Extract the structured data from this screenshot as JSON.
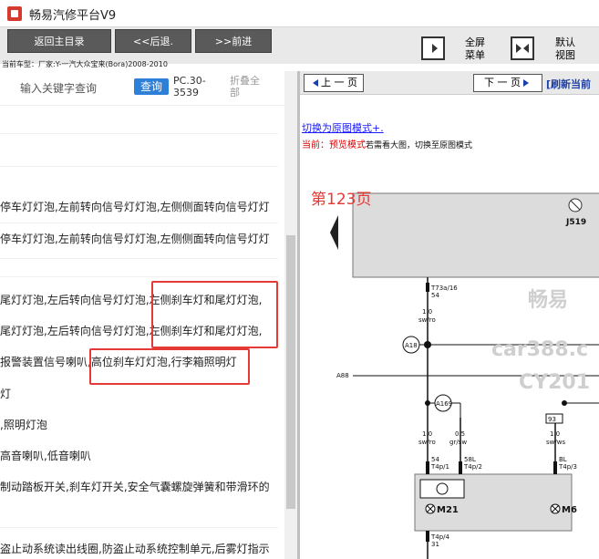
{
  "window": {
    "title": "畅易汽修平台V9"
  },
  "toolbar": {
    "home_label": "返回主目录",
    "back_label": "<<后退.",
    "forward_label": ">>前进",
    "fullscreen_label": "全屏",
    "menu_label": "菜单",
    "default_label": "默认",
    "view_label": "视图"
  },
  "vehicle_info": "当前车型：厂家:Y-一汽大众宝来(Bora)2008-2010",
  "search": {
    "keyword_label": "输入关键字查询",
    "query_button": "查询",
    "page_code": "PC.30-3539",
    "collapse_label": "折叠全部"
  },
  "results": [
    "停车灯灯泡,左前转向信号灯灯泡,左侧侧面转向信号灯灯",
    "停车灯灯泡,左前转向信号灯灯泡,左侧侧面转向信号灯灯",
    "尾灯灯泡,左后转向信号灯灯泡,左侧刹车灯和尾灯灯泡,",
    "尾灯灯泡,左后转向信号灯灯泡,左侧刹车灯和尾灯灯泡,",
    "报警装置信号喇叭,高位刹车灯灯泡,行李箱照明灯",
    "灯",
    ",照明灯泡",
    "高音喇叭,低音喇叭",
    "制动踏板开关,刹车灯开关,安全气囊螺旋弹簧和带滑环的",
    "盗止动系统读出线圈,防盗止动系统控制单元,后雾灯指示"
  ],
  "viewer": {
    "prev_page": "上 一 页",
    "next_page": "下 一 页",
    "refresh": "[刷新当前",
    "switch_mode_link": "切换为原图模式+.",
    "mode_prefix": "当前：",
    "mode_name": "预览模式",
    "mode_hint": "若需看大图，切换至原图模式",
    "page_number": "第123页"
  },
  "diagram": {
    "component_top": "J519",
    "conn_t73a": "T73a/16",
    "pin_54": "54",
    "wire_1_0_a": "1.0",
    "wire_sw_ro_a": "sw/ro",
    "conn_a18": "A18",
    "wire_a88": "A88",
    "conn_a169": "A169",
    "node_93": "93",
    "wire_1_0_b": "1.0",
    "wire_sw_ro_b": "sw/ro",
    "wire_0_5": "0.5",
    "wire_gr_sw": "gr/sw",
    "wire_1_0_c": "1.0",
    "wire_sw_ws": "sw/ws",
    "pin_54_b": "54",
    "conn_t4p1": "T4p/1",
    "pin_58l": "58L",
    "conn_t4p2": "T4p/2",
    "pin_bl": "BL",
    "conn_t4p3": "T4p/3",
    "lamp_m21": "M21",
    "lamp_m6": "M6",
    "conn_t4p4": "T4p/4",
    "pin_31": "31",
    "watermark_1": "畅易",
    "watermark_2": "car388.c",
    "watermark_3": "CY201"
  },
  "colors": {
    "accent_blue": "#2d7fd8",
    "highlight_red": "#e53935",
    "toolbar_gray": "#5a5a5a"
  }
}
